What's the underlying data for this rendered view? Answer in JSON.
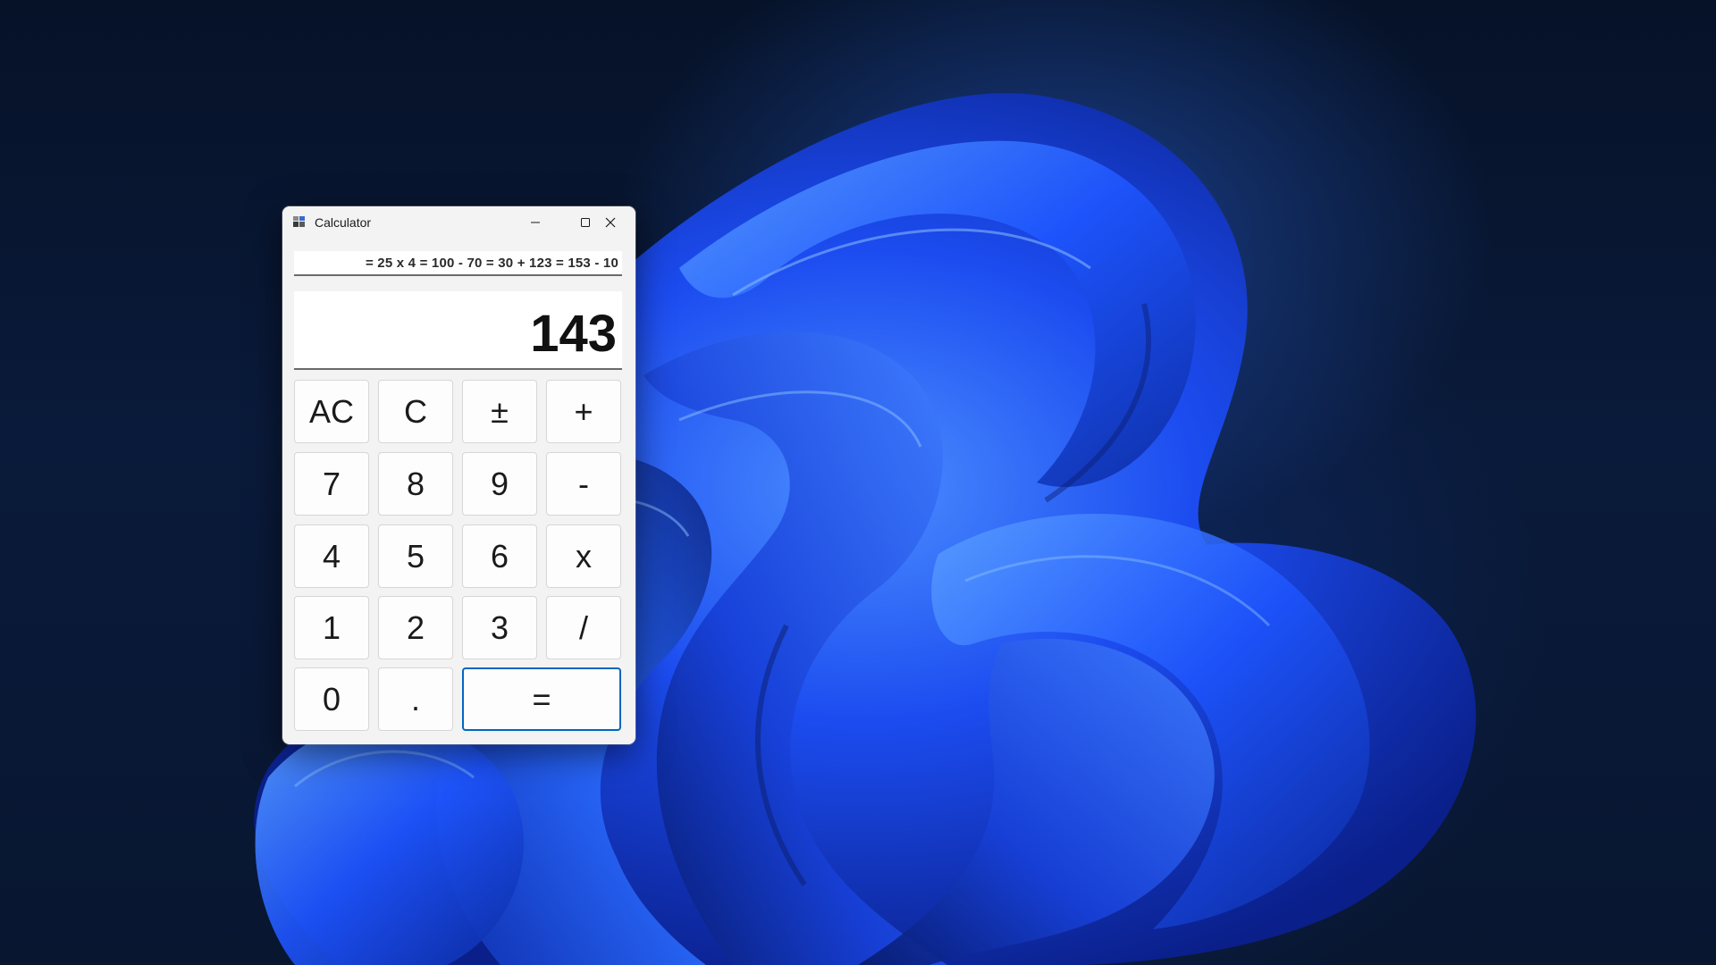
{
  "window": {
    "title": "Calculator"
  },
  "history": "= 25 x 4 = 100 - 70 = 30 + 123 = 153 - 10",
  "display": {
    "value": "143"
  },
  "keys": {
    "ac": "AC",
    "c": "C",
    "plus_minus": "±",
    "plus": "+",
    "seven": "7",
    "eight": "8",
    "nine": "9",
    "minus": "-",
    "four": "4",
    "five": "5",
    "six": "6",
    "multiply": "x",
    "one": "1",
    "two": "2",
    "three": "3",
    "divide": "/",
    "zero": "0",
    "decimal": ".",
    "equals": "="
  },
  "colors": {
    "accent": "#0067c0",
    "window_bg": "#f3f3f3",
    "wallpaper_blue": "#1f4fff"
  },
  "icons": {
    "app": "calculator-icon",
    "minimize": "minimize-icon",
    "maximize": "maximize-icon",
    "close": "close-icon"
  }
}
